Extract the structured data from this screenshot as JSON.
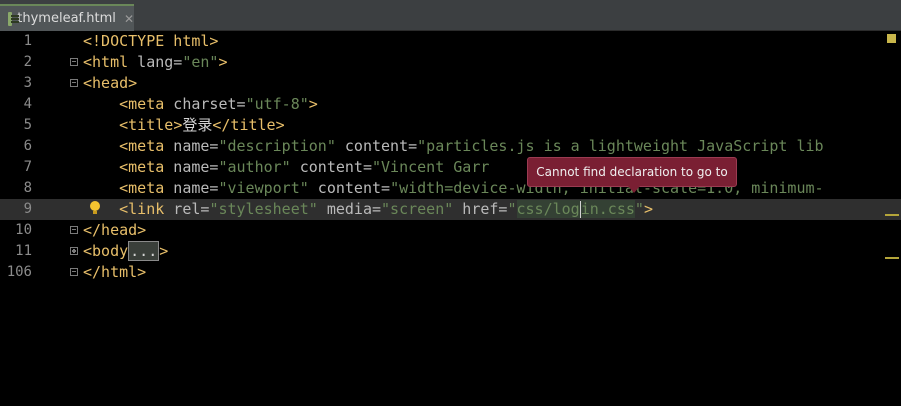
{
  "tab": {
    "filename": "thymeleaf.html",
    "close_symbol": "✕"
  },
  "tooltip": {
    "text": "Cannot find declaration to go to"
  },
  "lines": [
    {
      "number": "1"
    },
    {
      "number": "2"
    },
    {
      "number": "3"
    },
    {
      "number": "4"
    },
    {
      "number": "5"
    },
    {
      "number": "6"
    },
    {
      "number": "7"
    },
    {
      "number": "8"
    },
    {
      "number": "9"
    },
    {
      "number": "10"
    },
    {
      "number": "11"
    },
    {
      "number": "106"
    }
  ],
  "code": {
    "l1_doctype": "<!DOCTYPE html>",
    "l2_open": "<",
    "l2_tag": "html",
    "l2_attr": " lang=",
    "l2_val": "\"en\"",
    "l2_close": ">",
    "l3_text": "<head>",
    "l4_tag": "meta",
    "l4_attr": " charset=",
    "l4_val": "\"utf-8\"",
    "l5_tag": "title",
    "l5_text": "登录",
    "l5_close": "</title>",
    "l6_tag": "meta",
    "l6_attr1": " name=",
    "l6_val1": "\"description\"",
    "l6_attr2": " content=",
    "l6_val2": "\"particles.js is a lightweight JavaScript lib",
    "l7_tag": "meta",
    "l7_attr1": " name=",
    "l7_val1": "\"author\"",
    "l7_attr2": " content=",
    "l7_val2": "\"Vincent Garr",
    "l8_tag": "meta",
    "l8_attr1": " name=",
    "l8_val1": "\"viewport\"",
    "l8_attr2": " content=",
    "l8_val2": "\"width=device-width, initial-scale=1.0, minimum-",
    "l9_tag": "link",
    "l9_attr1": " rel=",
    "l9_val1": "\"stylesheet\"",
    "l9_attr2": " media=",
    "l9_val2": "\"screen\"",
    "l9_attr3": " href=",
    "l9_val3_q": "\"",
    "l9_val3_a": "css/log",
    "l9_val3_b": "in.css",
    "l9_val3_end": "\"",
    "l10_text": "</head>",
    "l11_open": "<body",
    "l11_folded": "...",
    "l11_close": ">",
    "l12_text": "</html>"
  },
  "colors": {
    "background": "#000000",
    "tag": "#e8bf6a",
    "attribute": "#bababa",
    "string": "#6a8759",
    "tooltip_bg": "#7a1f33"
  },
  "icons": {
    "bulb": "lightbulb-icon",
    "file": "html-file-icon"
  }
}
